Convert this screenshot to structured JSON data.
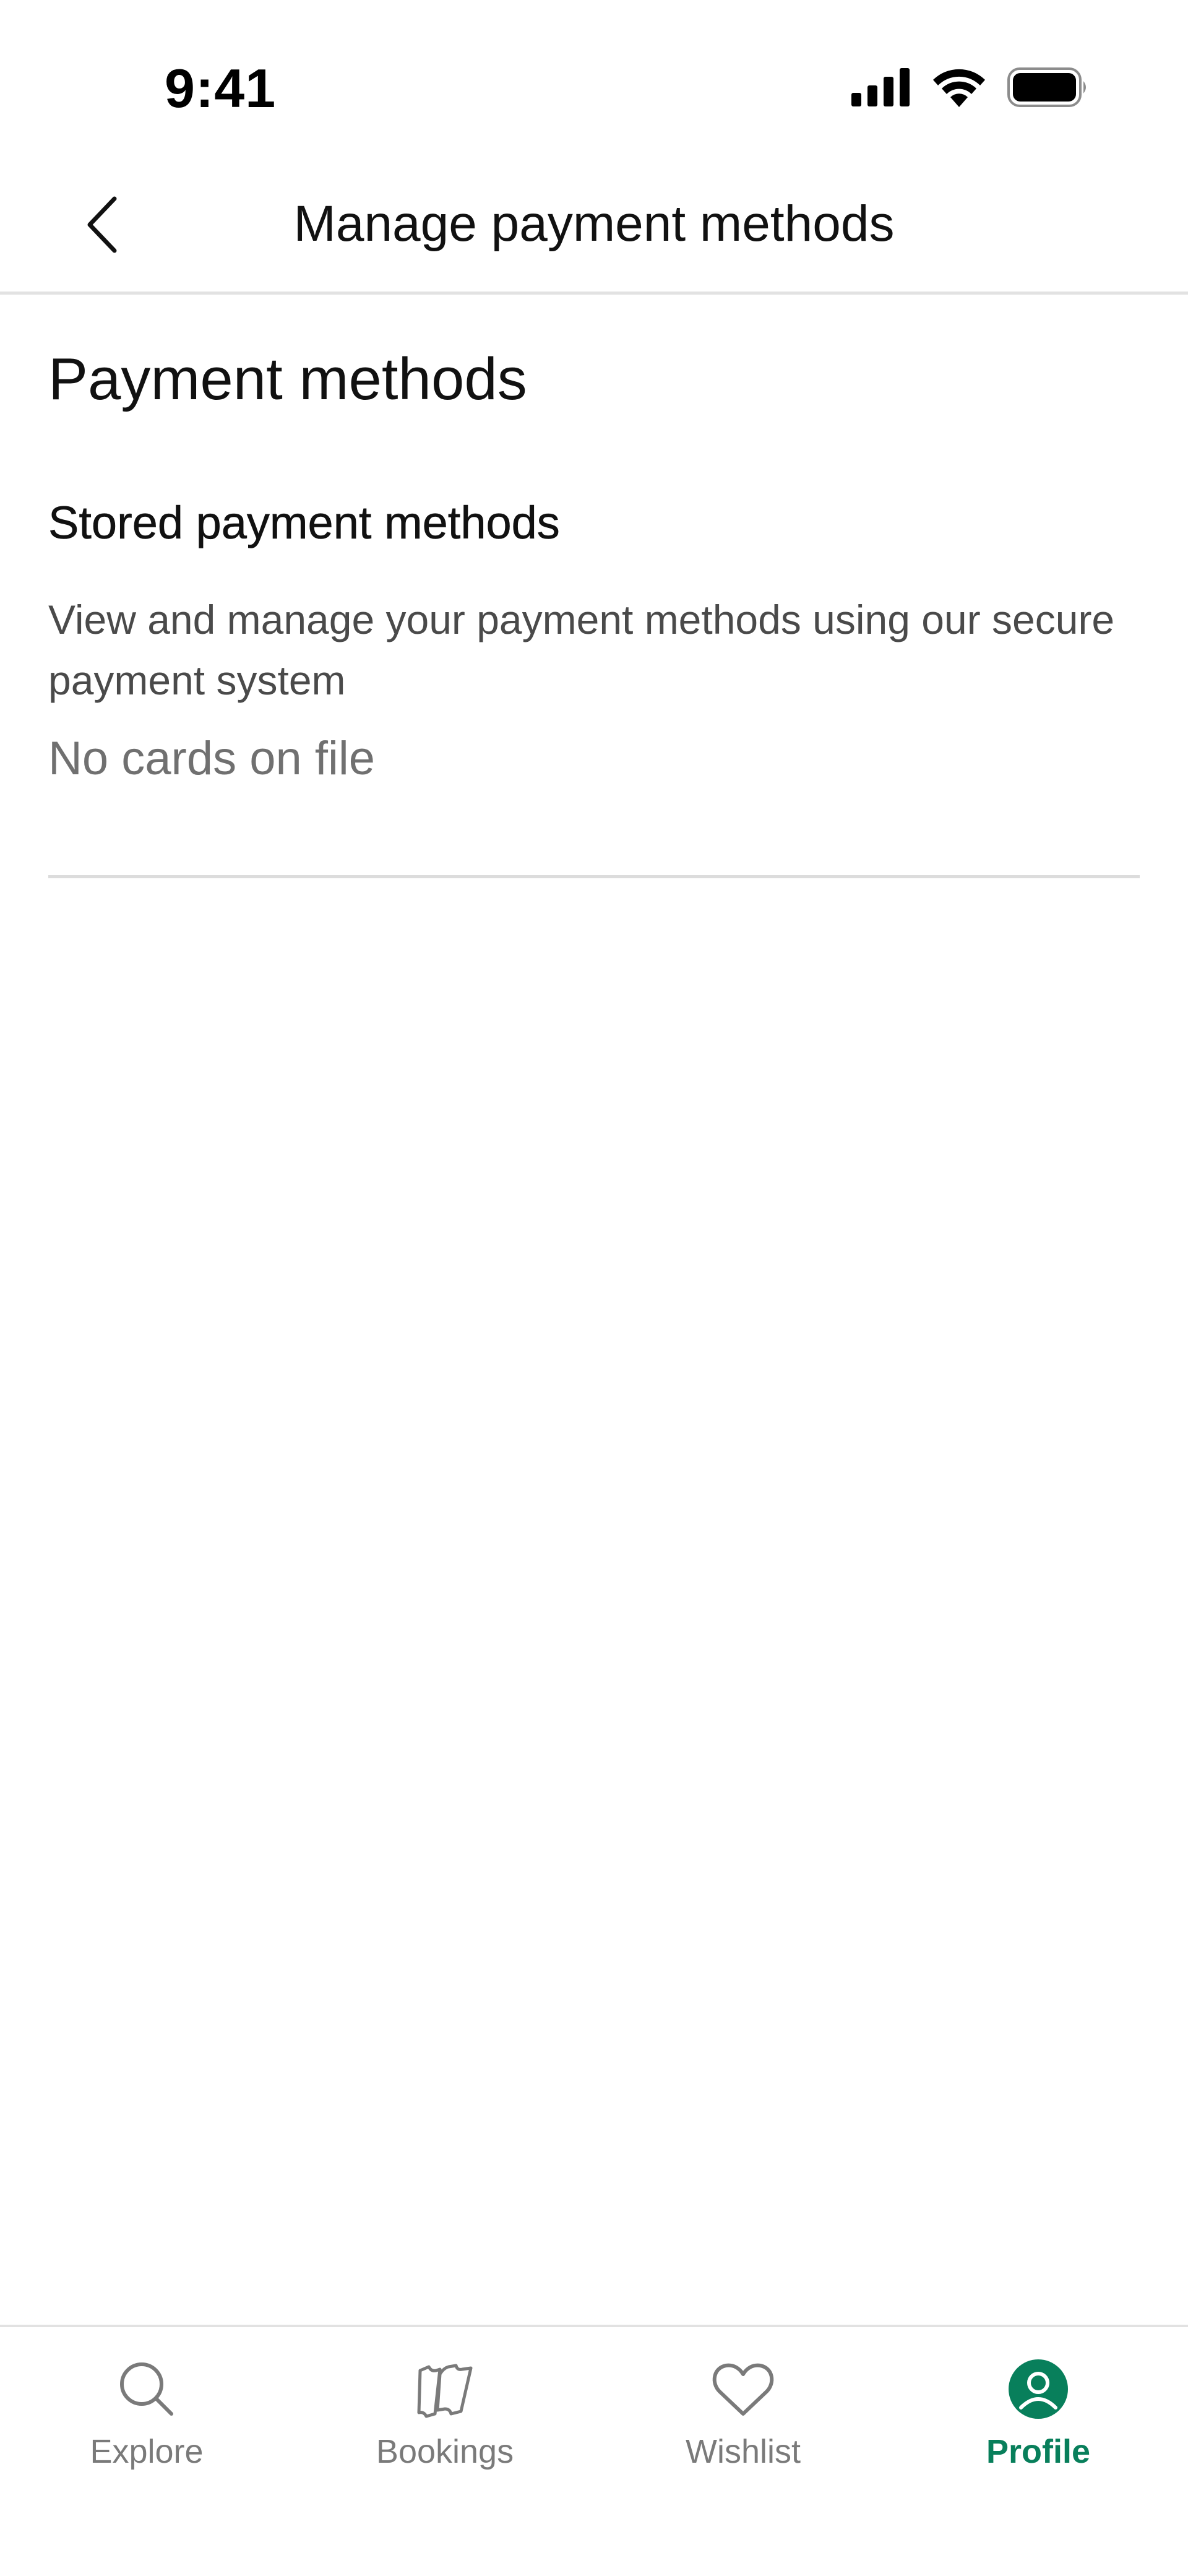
{
  "status_bar": {
    "time": "9:41",
    "icons": [
      "cellular-signal-icon",
      "wifi-icon",
      "battery-icon"
    ]
  },
  "header": {
    "back_icon": "chevron-left-icon",
    "title": "Manage payment methods"
  },
  "main": {
    "page_title": "Payment methods",
    "section": {
      "title": "Stored payment methods",
      "description": "View and manage your payment methods using our secure payment system",
      "empty_state": "No cards on file"
    }
  },
  "bottom_nav": {
    "items": [
      {
        "label": "Explore",
        "icon": "search-icon",
        "active": false
      },
      {
        "label": "Bookings",
        "icon": "tickets-icon",
        "active": false
      },
      {
        "label": "Wishlist",
        "icon": "heart-icon",
        "active": false
      },
      {
        "label": "Profile",
        "icon": "profile-icon",
        "active": true
      }
    ]
  },
  "colors": {
    "accent": "#087f5b",
    "inactive": "#7a7a7a",
    "divider": "#e2e2e2"
  }
}
